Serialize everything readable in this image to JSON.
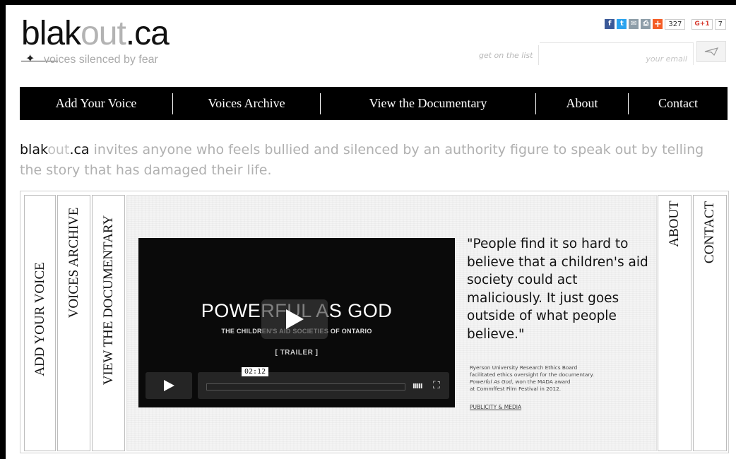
{
  "header": {
    "logo": {
      "part_bold": "blak",
      "part_light": "out",
      "part_tld": ".ca",
      "star": "✦"
    },
    "tagline": "voices silenced by fear",
    "social": {
      "facebook_icon": "f",
      "twitter_icon": "t",
      "email_icon": "✉",
      "print_icon": "⎙",
      "plus_icon": "+",
      "share_count": "327",
      "gplus_label": "G+1",
      "gplus_count": "7"
    },
    "signup": {
      "label": "get on the list",
      "placeholder": "your email"
    }
  },
  "nav": {
    "items": [
      {
        "label": "Add Your Voice"
      },
      {
        "label": "Voices Archive"
      },
      {
        "label": "View the Documentary"
      },
      {
        "label": "About"
      },
      {
        "label": "Contact"
      }
    ]
  },
  "intro": {
    "brand_bold": "blak",
    "brand_light": "out",
    "brand_tld": ".ca",
    "text": " invites anyone who feels bullied and silenced by an authority figure to speak out by telling the story that has damaged their life."
  },
  "side_tabs": {
    "left": [
      "ADD YOUR VOICE",
      "VOICES ARCHIVE",
      "VIEW THE DOCUMENTARY"
    ],
    "right": [
      "ABOUT",
      "CONTACT"
    ]
  },
  "video": {
    "title": "POWERFUL AS GOD",
    "subtitle": "THE CHILDREN'S AID SOCIETIES OF ONTARIO",
    "trailer": "[ TRAILER ]",
    "time": "02:12",
    "volume_glyph": "IIIII",
    "fullscreen_glyph": "⛶"
  },
  "quote": {
    "text": "\"People find it so hard to believe that a children's aid society could act maliciously. It just goes outside of what people believe.\""
  },
  "ethics": {
    "line1": "Ryerson University Research Ethics Board",
    "line2": "facilitated ethics oversight for the documentary.",
    "film": "Powerful As God",
    "line3": ", won the MADA award",
    "line4": "at Commffest Film Festival in 2012."
  },
  "publicity_link": "PUBLICITY & MEDIA",
  "colors": {
    "nav_bg": "#000000",
    "facebook": "#3b5998",
    "twitter": "#2aa3ef",
    "plus": "#f45c25",
    "muted_text": "#b0b0b0"
  }
}
